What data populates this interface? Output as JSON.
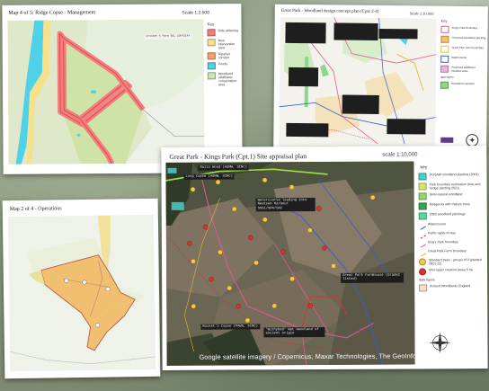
{
  "sheet_ridge": {
    "title": "Map 4 of 5: Ridge Copse - Management",
    "scale": "Scale 1:2,500",
    "key_heading": "Key",
    "key": [
      {
        "label": "Ride widening",
        "color": "#f08080"
      },
      {
        "label": "New intervention area",
        "color": "#f7e08a"
      },
      {
        "label": "Riparian corridor",
        "color": "#f4a26b"
      },
      {
        "label": "Ponds",
        "color": "#4fd1e8"
      },
      {
        "label": "Woodland wildflower conservation area",
        "color": "#c9e7b3"
      }
    ],
    "map_labels": [
      "Crocker's Farm  SSL 1DG43144"
    ]
  },
  "sheet_woodland": {
    "title": "Great Park - Woodland design concept plan (Cpts 2-4)",
    "scale": "Scale 1:10,000",
    "key_heading": "Key",
    "key": [
      {
        "label": "King's Park boundary",
        "color": "#e05a9a"
      },
      {
        "label": "Proposed woodland planting",
        "color": "#f6c36a"
      },
      {
        "label": "Great Park Farm boundary",
        "color": "#f0c030"
      },
      {
        "label": "Watercourse",
        "color": "#3a5cc6"
      },
      {
        "label": "Proposed wildflower meadow area",
        "color": "#e9b3e3"
      },
      {
        "label": "data layers",
        "color": "#ffffff"
      },
      {
        "label": "Woodland corridors",
        "color": "#8fd68a"
      }
    ]
  },
  "sheet_ops": {
    "title": "Map 2 of 4 - Operations"
  },
  "sheet_appraisal": {
    "title": "Great Park - Kings Park (Cpt.1) Site appraisal plan",
    "scale": "scale 1:10,000",
    "key_heading": "key",
    "key": [
      {
        "label": "JIGSAW woodland planting (2004)",
        "color": "#49d0c6"
      },
      {
        "label": "Park boundary restoration (tree and hedge planting 2021)",
        "color": "#d7e86e"
      },
      {
        "label": "Semi-natural woodland",
        "color": "#9ad46e"
      },
      {
        "label": "Hedgerow with mature trees",
        "color": "#3aa356"
      },
      {
        "label": "2002 woodland plantings",
        "color": "#5fd39f"
      },
      {
        "label": "Watercourse",
        "color": "#3a5cc6"
      },
      {
        "label": "Public rights of way",
        "color": "#c8283c"
      },
      {
        "label": "King's Park boundary",
        "color": "#e05a9a"
      },
      {
        "label": "Great Park Farm boundary",
        "color": "#e8b830"
      },
      {
        "label": "Standard trees - groups of 9 (planted 2021-22)",
        "color": "#f7c948"
      },
      {
        "label": "Mini-ripper creation areas 5 ha",
        "color": "#e03030"
      },
      {
        "label": "data layers",
        "color": "#ffffff"
      },
      {
        "label": "Ancient Woodlands England",
        "color": "#f3e1c8"
      }
    ],
    "map_labels": {
      "rails_wood": "Rails Wood (ASNW, SINC)",
      "long_copse": "Long Copse (ASNW, SINC)",
      "watercourse": "Watercourse leading into Newtown Harbour SSSI/SPA/SAC",
      "farmhouse": "Great Park Farmhouse (Grade2 listed)",
      "buckets_copse": "Bucket's Copse (PAWS, SINC)",
      "withybed": "'Withybed' Wet woodland of ancient origin"
    },
    "attribution": "Google  satellite imagery / Copernicus, Maxar Technologies, The GeoInformation Group"
  }
}
